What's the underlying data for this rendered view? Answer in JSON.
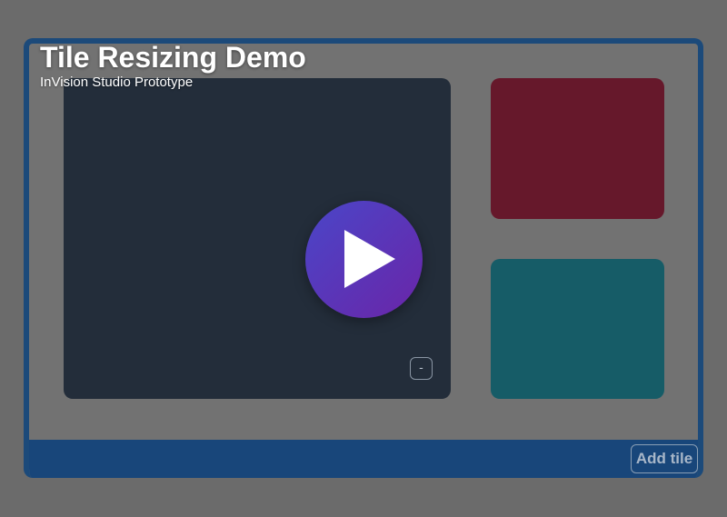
{
  "header": {
    "title": "Tile Resizing Demo",
    "subtitle": "InVision Studio Prototype"
  },
  "tiles": {
    "main_tile": {
      "color": "#232d3a",
      "minimize_label": "-"
    },
    "red_tile": {
      "color": "#66182b"
    },
    "teal_tile": {
      "color": "#165c67"
    }
  },
  "footer": {
    "add_tile_label": "Add tile",
    "bar_color": "#18467a"
  },
  "overlay": {
    "play_icon": "play-icon",
    "gradient_start": "#4a46c8",
    "gradient_end": "#6a25a8"
  }
}
